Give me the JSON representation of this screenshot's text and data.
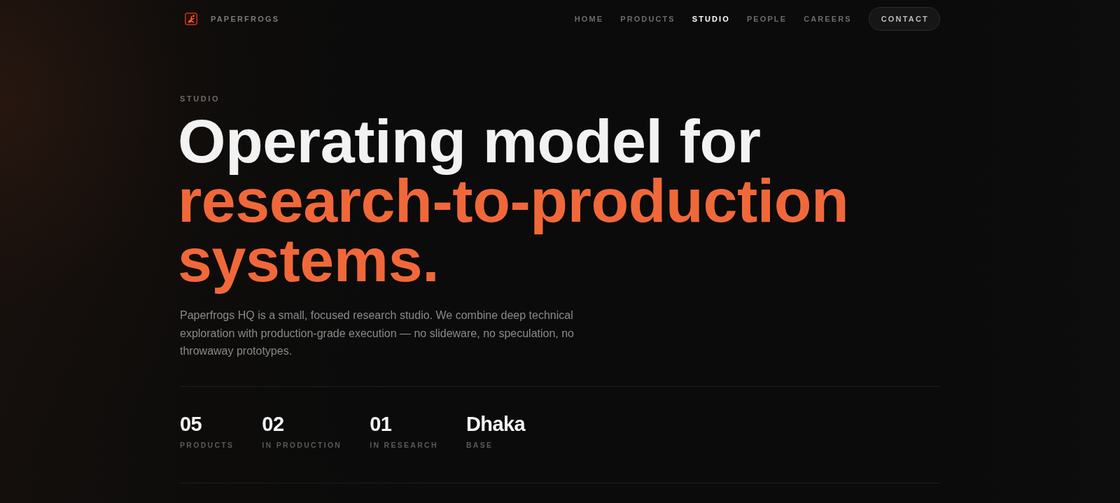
{
  "brand": {
    "name": "PAPERFROGS"
  },
  "nav": {
    "links": [
      {
        "label": "HOME",
        "selected": false
      },
      {
        "label": "PRODUCTS",
        "selected": false
      },
      {
        "label": "STUDIO",
        "selected": true
      },
      {
        "label": "PEOPLE",
        "selected": false
      },
      {
        "label": "CAREERS",
        "selected": false
      }
    ],
    "contact_button": {
      "label": "CONTACT"
    }
  },
  "hero": {
    "eyebrow": "STUDIO",
    "heading": [
      {
        "text": "Operating model for",
        "accent": false
      },
      {
        "text": "research-to-production systems.",
        "accent": true
      }
    ],
    "description": "Paperfrogs HQ is a small, focused research studio. We combine deep technical exploration with production-grade execution — no slideware, no speculation, no throwaway prototypes."
  },
  "stats": [
    {
      "value": "05",
      "label": "PRODUCTS"
    },
    {
      "value": "02",
      "label": "IN PRODUCTION"
    },
    {
      "value": "01",
      "label": "IN RESEARCH"
    },
    {
      "value": "Dhaka",
      "label": "BASE"
    }
  ]
}
